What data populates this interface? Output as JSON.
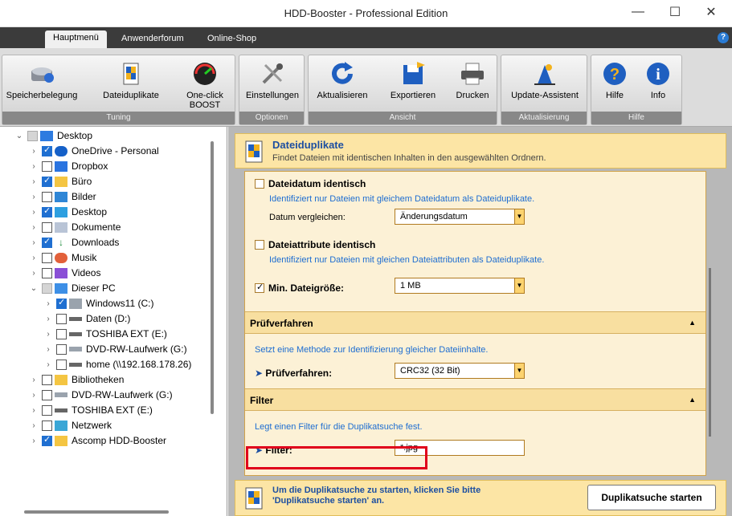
{
  "window": {
    "title": "HDD-Booster - Professional Edition",
    "minimize": "—",
    "maximize": "☐",
    "close": "✕"
  },
  "menu": {
    "tabs": [
      "Hauptmenü",
      "Anwenderforum",
      "Online-Shop"
    ],
    "help": "?"
  },
  "ribbon": {
    "groups": [
      "Tuning",
      "Optionen",
      "Ansicht",
      "Aktualisierung",
      "Hilfe"
    ],
    "buttons": {
      "speicher": "Speicherbelegung",
      "duplikate": "Dateiduplikate",
      "oneclick1": "One-click",
      "oneclick2": "BOOST",
      "einstellungen": "Einstellungen",
      "aktualisieren": "Aktualisieren",
      "exportieren": "Exportieren",
      "drucken": "Drucken",
      "update": "Update-Assistent",
      "hilfe": "Hilfe",
      "info": "Info"
    }
  },
  "tree": [
    {
      "label": "Desktop"
    },
    {
      "label": "OneDrive - Personal"
    },
    {
      "label": "Dropbox"
    },
    {
      "label": "Büro"
    },
    {
      "label": "Bilder"
    },
    {
      "label": "Desktop"
    },
    {
      "label": "Dokumente"
    },
    {
      "label": "Downloads"
    },
    {
      "label": "Musik"
    },
    {
      "label": "Videos"
    },
    {
      "label": "Dieser PC"
    },
    {
      "label": "Windows11 (C:)"
    },
    {
      "label": "Daten (D:)"
    },
    {
      "label": "TOSHIBA EXT (E:)"
    },
    {
      "label": "DVD-RW-Laufwerk (G:)"
    },
    {
      "label": "home (\\\\192.168.178.26)"
    },
    {
      "label": "Bibliotheken"
    },
    {
      "label": "DVD-RW-Laufwerk (G:)"
    },
    {
      "label": "TOSHIBA EXT (E:)"
    },
    {
      "label": "Netzwerk"
    },
    {
      "label": "Ascomp HDD-Booster"
    }
  ],
  "header": {
    "title": "Dateiduplikate",
    "subtitle": "Findet Dateien mit identischen Inhalten in den ausgewählten Ordnern."
  },
  "options": {
    "datum_title": "Dateidatum identisch",
    "datum_desc": "Identifiziert nur Dateien mit gleichem Dateidatum als Dateiduplikate.",
    "datum_label": "Datum vergleichen:",
    "datum_value": "Änderungsdatum",
    "attr_title": "Dateiattribute identisch",
    "attr_desc": "Identifiziert nur Dateien mit gleichen Dateiattributen als Dateiduplikate.",
    "size_label": "Min. Dateigröße:",
    "size_value": "1 MB"
  },
  "pruef": {
    "section": "Prüfverfahren",
    "desc": "Setzt eine Methode zur Identifizierung gleicher Dateiinhalte.",
    "label": "Prüfverfahren:",
    "value": "CRC32 (32 Bit)"
  },
  "filter": {
    "section": "Filter",
    "desc": "Legt einen Filter für die Duplikatsuche fest.",
    "label": "Filter:",
    "value": "*.jpg"
  },
  "footer": {
    "msg1": "Um die Duplikatsuche zu starten, klicken Sie bitte",
    "msg2": "'Duplikatsuche starten' an.",
    "button": "Duplikatsuche starten"
  },
  "colors": {
    "accent": "#1d4fa1",
    "panel": "#fce5a5",
    "highlight": "#e0001b"
  }
}
